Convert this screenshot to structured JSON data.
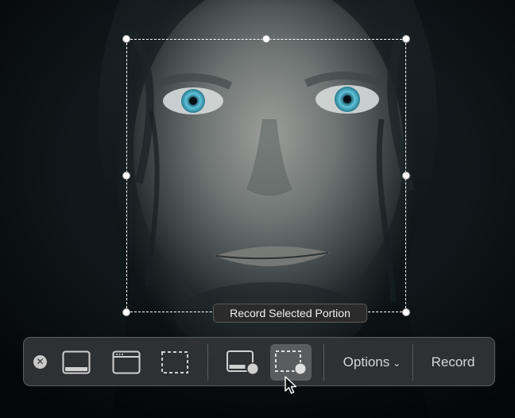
{
  "tooltip": {
    "text": "Record Selected Portion"
  },
  "toolbar": {
    "close_icon": "close-icon",
    "buttons": [
      {
        "name": "capture-entire-screen",
        "icon": "screen-icon"
      },
      {
        "name": "capture-selected-window",
        "icon": "window-icon"
      },
      {
        "name": "capture-selected-portion",
        "icon": "selection-icon"
      },
      {
        "name": "record-entire-screen",
        "icon": "record-screen-icon"
      },
      {
        "name": "record-selected-portion",
        "icon": "record-selection-icon",
        "selected": true
      }
    ],
    "options_label": "Options",
    "record_label": "Record"
  },
  "colors": {
    "toolbar_bg": "#323436",
    "active_button_bg": "#5a5c5e",
    "text": "#d6d6d6",
    "selection_border": "#ffffff"
  }
}
